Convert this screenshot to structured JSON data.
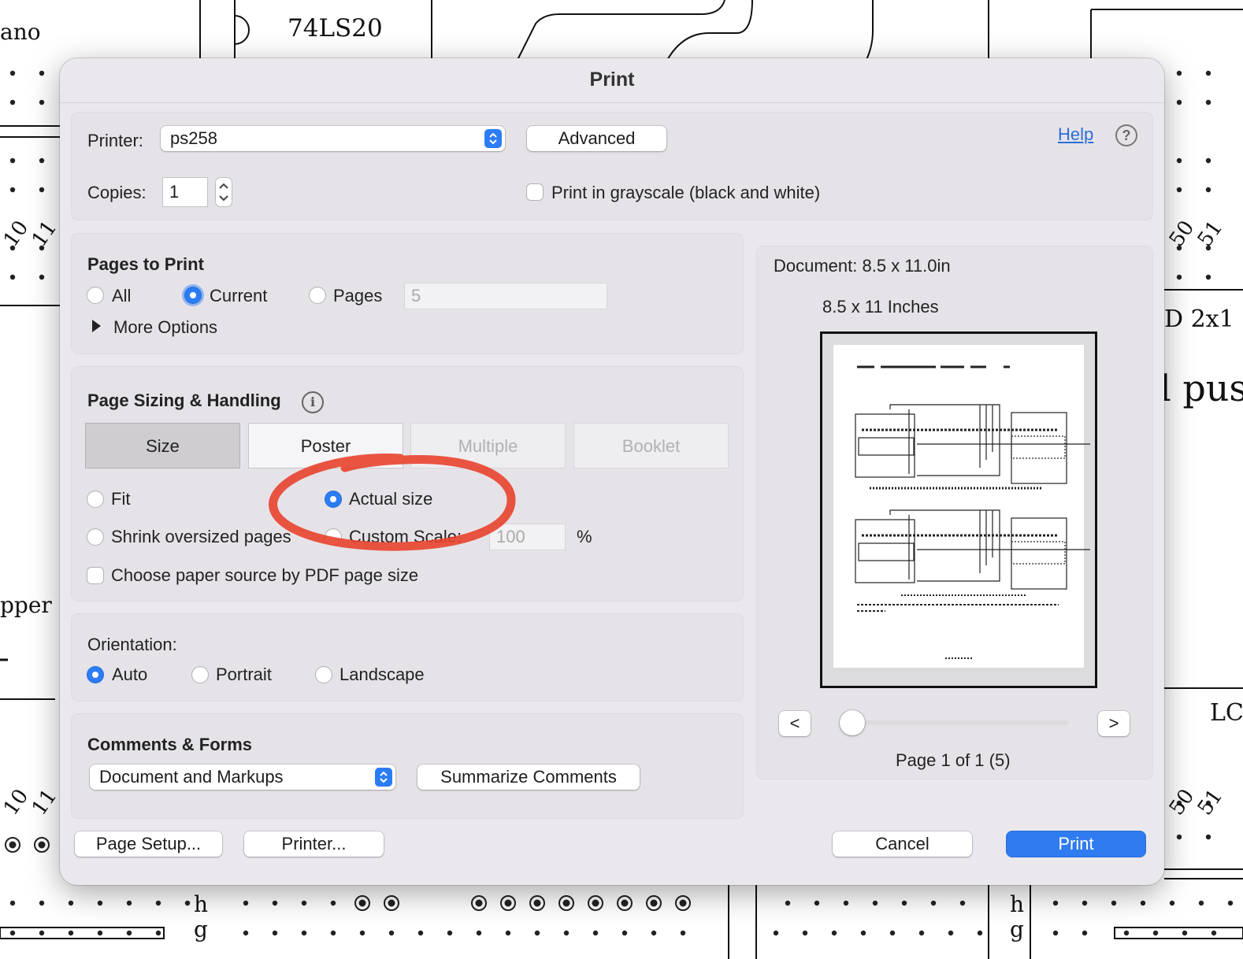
{
  "background": {
    "chip_label": "74LS20",
    "fragment_ano": "ano",
    "fragment_pper": "pper",
    "fragment_d2x1": "D 2x1",
    "fragment_pus": "l pus",
    "fragment_lc": "LC",
    "pin_10_top": "10",
    "pin_11_top": "11",
    "pin_50_top": "50",
    "pin_51_top": "51",
    "pin_10_bottom": "10",
    "pin_11_bottom": "11",
    "pin_50_bottom": "50",
    "pin_51_bottom": "51",
    "row_h_left": "h",
    "row_g_left": "g",
    "row_h_right": "h",
    "row_g_right": "g"
  },
  "dialog": {
    "title": "Print",
    "printer": {
      "label": "Printer:",
      "value": "ps258",
      "advanced_label": "Advanced",
      "help_label": "Help",
      "help_icon": "?"
    },
    "copies": {
      "label": "Copies:",
      "value": "1",
      "grayscale_label": "Print in grayscale (black and white)",
      "grayscale_checked": false
    },
    "pages_to_print": {
      "header": "Pages to Print",
      "all_label": "All",
      "current_label": "Current",
      "pages_label": "Pages",
      "pages_value": "5",
      "selected": "Current",
      "more_options_label": "More Options"
    },
    "page_sizing": {
      "header": "Page Sizing & Handling",
      "info_icon": "i",
      "tabs": [
        "Size",
        "Poster",
        "Multiple",
        "Booklet"
      ],
      "selected_tab": "Size",
      "fit_label": "Fit",
      "actual_size_label": "Actual size",
      "shrink_label": "Shrink oversized pages",
      "custom_scale_label": "Custom Scale:",
      "custom_scale_value": "100",
      "percent_sign": "%",
      "paper_source_label": "Choose paper source by PDF page size",
      "selected_option": "Actual size",
      "annotation_color": "#e8432d"
    },
    "orientation": {
      "label": "Orientation:",
      "auto_label": "Auto",
      "portrait_label": "Portrait",
      "landscape_label": "Landscape",
      "selected": "Auto"
    },
    "comments_forms": {
      "header": "Comments & Forms",
      "value": "Document and Markups",
      "summarize_label": "Summarize Comments"
    },
    "preview": {
      "document_label": "Document: 8.5 x 11.0in",
      "paper_label": "8.5 x 11 Inches",
      "prev_label": "<",
      "next_label": ">",
      "page_status": "Page 1 of 1 (5)"
    },
    "footer": {
      "page_setup_label": "Page Setup...",
      "printer_label": "Printer...",
      "cancel_label": "Cancel",
      "print_label": "Print"
    },
    "colors": {
      "accent": "#2f7bf0",
      "dialog_bg": "#ebe8ed",
      "link": "#2b6fd6"
    }
  }
}
